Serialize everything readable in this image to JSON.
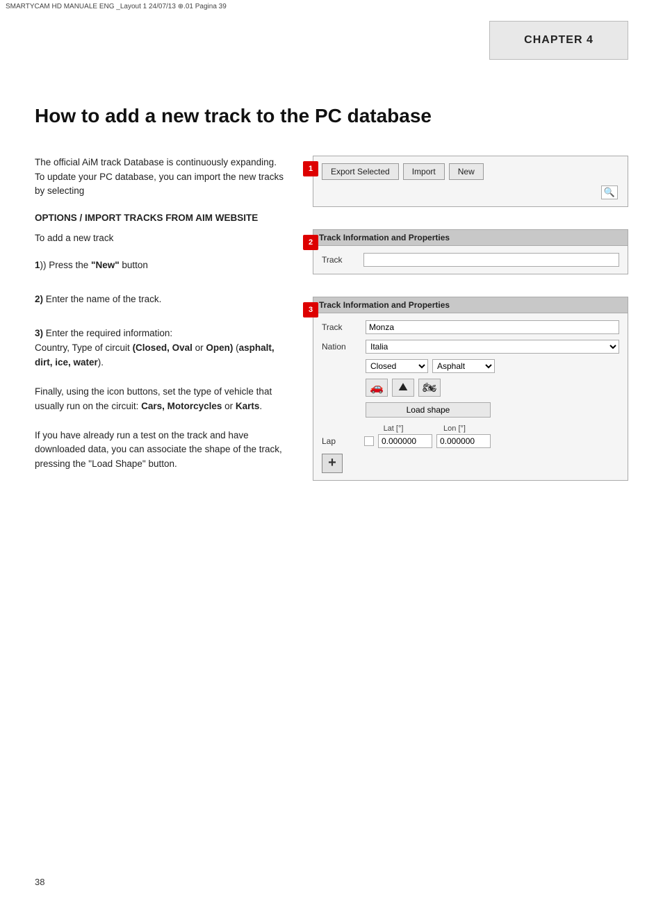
{
  "header": {
    "text": "SMARTYCAM HD MANUALE ENG _Layout 1  24/07/13  ⊕.01  Pagina 39"
  },
  "chapter": {
    "label": "CHAPTER 4"
  },
  "page": {
    "title": "How to add a new track to the PC database",
    "number": "38"
  },
  "body": {
    "intro_para1": "The official AiM track Database is continuously expanding.",
    "intro_para2": "To update your PC database, you can import the new tracks by selecting",
    "options_heading": "OPTIONS / IMPORT TRACKS FROM AIM WEBSITE",
    "add_track_text": "To add a  new track",
    "step1_text": "1)) Press the “New” button",
    "step2_text": "2) Enter the name of the track.",
    "step3_text": "3) Enter the required information:\nCountry, Type of circuit (Closed, Oval or Open) (asphalt, dirt, ice, water).",
    "step3_para2": "Finally, using the icon buttons, set the type of vehicle that usually run on the circuit: Cars, Motorcycles or Karts.",
    "step3_para3": "If you have already run a test on the track and have downloaded data, you can associate the shape of the track, pressing the “Load Shape” button."
  },
  "panel1": {
    "badge": "1",
    "export_btn": "Export Selected",
    "import_btn": "Import",
    "new_btn": "New",
    "search_icon": "🔍"
  },
  "panel2": {
    "badge": "2",
    "title": "Track Information and Properties",
    "track_label": "Track",
    "track_value": ""
  },
  "panel3": {
    "badge": "3",
    "title": "Track Information and Properties",
    "track_label": "Track",
    "track_value": "Monza",
    "nation_label": "Nation",
    "nation_value": "Italia",
    "circuit_type": "Closed",
    "surface_type": "Asphalt",
    "car_icon": "🚗",
    "mountain_icon": "⛰",
    "moto_icon": "🏍",
    "load_shape_btn": "Load shape",
    "lat_header": "Lat [°]",
    "lon_header": "Lon [°]",
    "lap_label": "Lap",
    "lat_value": "0.000000",
    "lon_value": "0.000000",
    "add_btn": "+"
  }
}
